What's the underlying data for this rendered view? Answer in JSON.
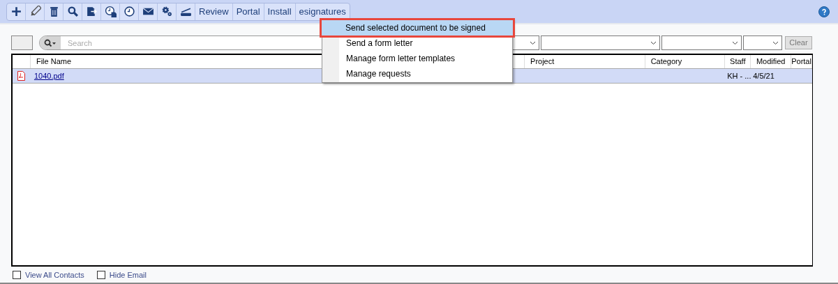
{
  "toolbar": {
    "icon_buttons": [
      {
        "kind": "plus"
      },
      {
        "kind": "pencil"
      },
      {
        "kind": "trash"
      },
      {
        "kind": "search"
      },
      {
        "kind": "export"
      },
      {
        "kind": "clock-document"
      },
      {
        "kind": "clock"
      },
      {
        "kind": "envelope"
      },
      {
        "kind": "gears"
      },
      {
        "kind": "scanner"
      }
    ],
    "text_buttons": [
      {
        "label": "Review"
      },
      {
        "label": "Portal"
      },
      {
        "label": "Install"
      },
      {
        "label": "esignatures"
      }
    ]
  },
  "menu": {
    "items": [
      {
        "label": "Send selected document to be signed",
        "selected": true
      },
      {
        "label": "Send a form letter",
        "selected": false
      },
      {
        "label": "Manage form letter templates",
        "selected": false
      },
      {
        "label": "Manage requests",
        "selected": false
      }
    ]
  },
  "filter": {
    "search_placeholder": "Search",
    "clear_button": "Clear"
  },
  "table": {
    "columns": [
      "File Name",
      "Project",
      "Category",
      "Staff",
      "Modified",
      "Portal"
    ],
    "rows": [
      {
        "selected": true,
        "file": "1040.pdf",
        "project": "",
        "category": "",
        "staff": "KH - ...",
        "modified": "4/5/21",
        "portal": ""
      }
    ]
  },
  "options": [
    {
      "label": "View All Contacts",
      "checked": false
    },
    {
      "label": "Hide Email",
      "checked": false
    }
  ]
}
